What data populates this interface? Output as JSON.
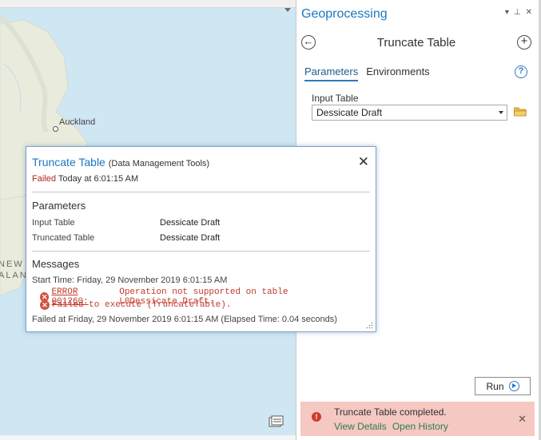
{
  "map": {
    "labels": {
      "city": "Auckland",
      "country_line1": "NEW",
      "country_line2": "ALAN"
    }
  },
  "pane": {
    "title": "Geoprocessing",
    "controls": {
      "dropdown": "▾",
      "pin": "⊥",
      "close": "✕"
    },
    "tool_title": "Truncate Table",
    "tabs": [
      {
        "label": "Parameters",
        "active": true
      },
      {
        "label": "Environments",
        "active": false
      }
    ],
    "input_table_label": "Input Table",
    "input_table_value": "Dessicate Draft",
    "run_label": "Run",
    "notification": {
      "text": "Truncate Table completed.",
      "view_details": "View Details",
      "open_history": "Open History",
      "close": "✕"
    }
  },
  "popup": {
    "title": "Truncate Table",
    "subtitle": "(Data Management Tools)",
    "status_label": "Failed",
    "status_time": "Today at 6:01:15 AM",
    "parameters_heading": "Parameters",
    "parameters": [
      {
        "name": "Input Table",
        "value": "Dessicate Draft"
      },
      {
        "name": "Truncated Table",
        "value": "Dessicate Draft"
      }
    ],
    "messages_heading": "Messages",
    "start_time": "Start Time: Friday, 29 November 2019 6:01:15 AM",
    "errors": [
      {
        "code": "ERROR 001260:",
        "text": " Operation not supported on table L0Dessicate_Draft."
      },
      {
        "code": "",
        "text": "Failed to execute (TruncateTable)."
      }
    ],
    "failed_at": "Failed at Friday, 29 November 2019 6:01:15 AM (Elapsed Time: 0.04 seconds)"
  },
  "colors": {
    "accent": "#1a78c2",
    "error": "#c0392b",
    "notify_bg": "#f6c8c2",
    "link": "#2c7a55"
  }
}
